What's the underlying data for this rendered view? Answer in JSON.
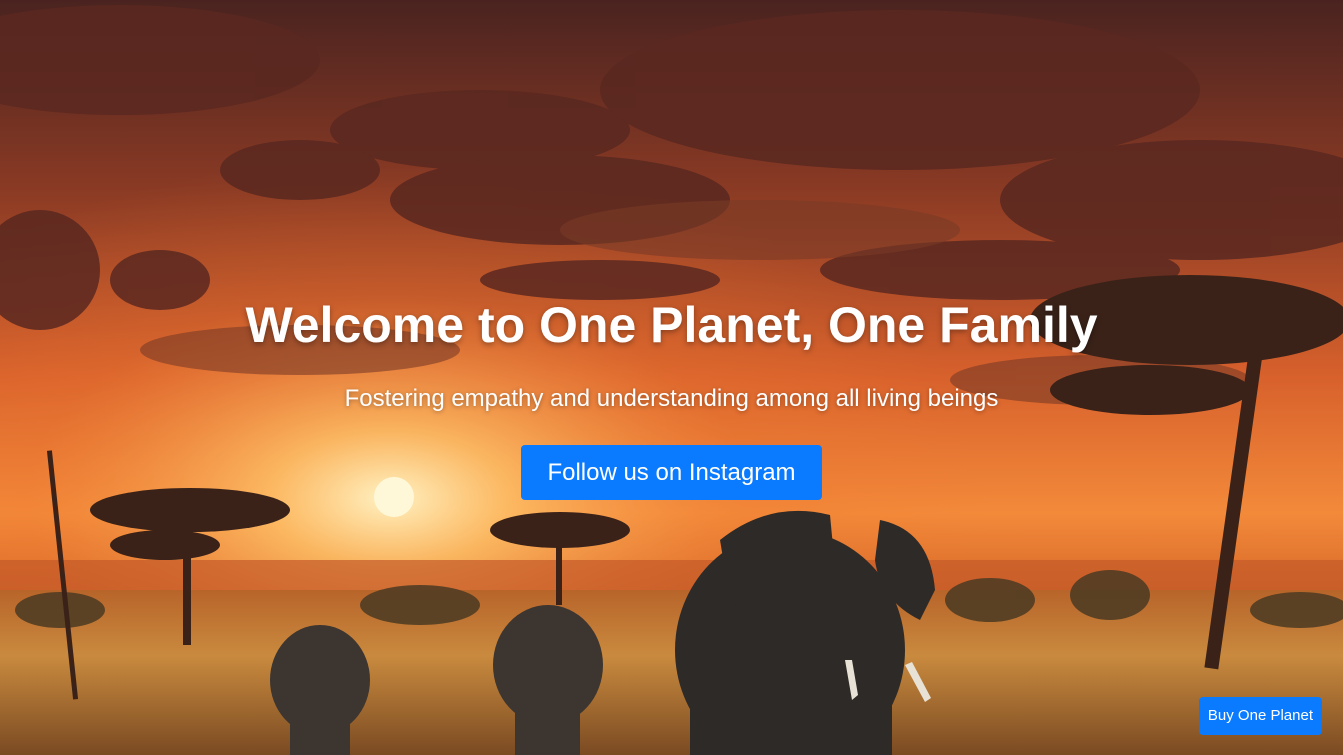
{
  "hero": {
    "title": "Welcome to One Planet, One Family",
    "subtitle": "Fostering empathy and understanding among all living beings",
    "cta_label": "Follow us on Instagram",
    "background": "savanna-sunset-elephants-image"
  },
  "floating": {
    "buy_label": "Buy One Planet"
  },
  "colors": {
    "button": "#0a7bff",
    "text": "#ffffff"
  }
}
